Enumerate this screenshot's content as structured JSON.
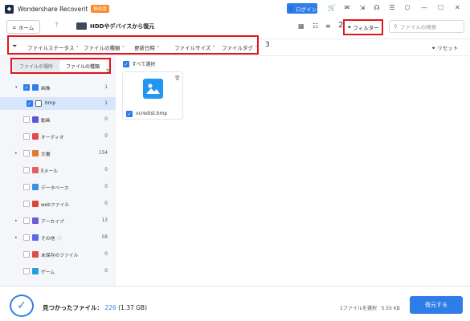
{
  "app": {
    "title": "Wondershare Recoverit",
    "badge": "無料版",
    "login": "ログイン"
  },
  "nav": {
    "home": "ホーム",
    "path": "HDDやデバイスから復元",
    "filter": "フィルター",
    "search_placeholder": "ファイルの検索",
    "mark2": "2"
  },
  "filterbar": {
    "items": [
      "ファイルステータス",
      "ファイルの種類",
      "更新日時",
      "ファイルサイズ",
      "ファイルタグ"
    ],
    "reset": "リセット",
    "mark3": "3"
  },
  "sidebar": {
    "tabs": [
      "ファイルの場所",
      "ファイルの種類"
    ],
    "mark1": "1",
    "items": [
      {
        "label": "画像",
        "count": "1",
        "color": "#2e7de8",
        "checked": true,
        "expanded": true
      },
      {
        "label": "bmp",
        "count": "1",
        "checked": true
      },
      {
        "label": "動画",
        "count": "0",
        "color": "#5a57d8"
      },
      {
        "label": "オーディオ",
        "count": "0",
        "color": "#e04a4a"
      },
      {
        "label": "文書",
        "count": "154",
        "color": "#e07a2e"
      },
      {
        "label": "Eメール",
        "count": "0",
        "color": "#e26060"
      },
      {
        "label": "データベース",
        "count": "0",
        "color": "#3a8fe0"
      },
      {
        "label": "webファイル",
        "count": "0",
        "color": "#e0453a"
      },
      {
        "label": "アーカイブ",
        "count": "13",
        "color": "#6b5fd6"
      },
      {
        "label": "その他",
        "count": "58",
        "color": "#5a6be0"
      },
      {
        "label": "未保存のファイル",
        "count": "0",
        "color": "#e04a4a"
      },
      {
        "label": "ゲーム",
        "count": "0",
        "color": "#2a9be0"
      }
    ]
  },
  "main": {
    "select_all": "すべて選択",
    "file": {
      "name": "vcredist.bmp"
    }
  },
  "footer": {
    "found_label": "見つかったファイル：",
    "found_count": "226",
    "found_size": "(1.37 GB)",
    "selection": "1ファイルを選択",
    "size": "5.55 KB",
    "recover": "復元する"
  }
}
